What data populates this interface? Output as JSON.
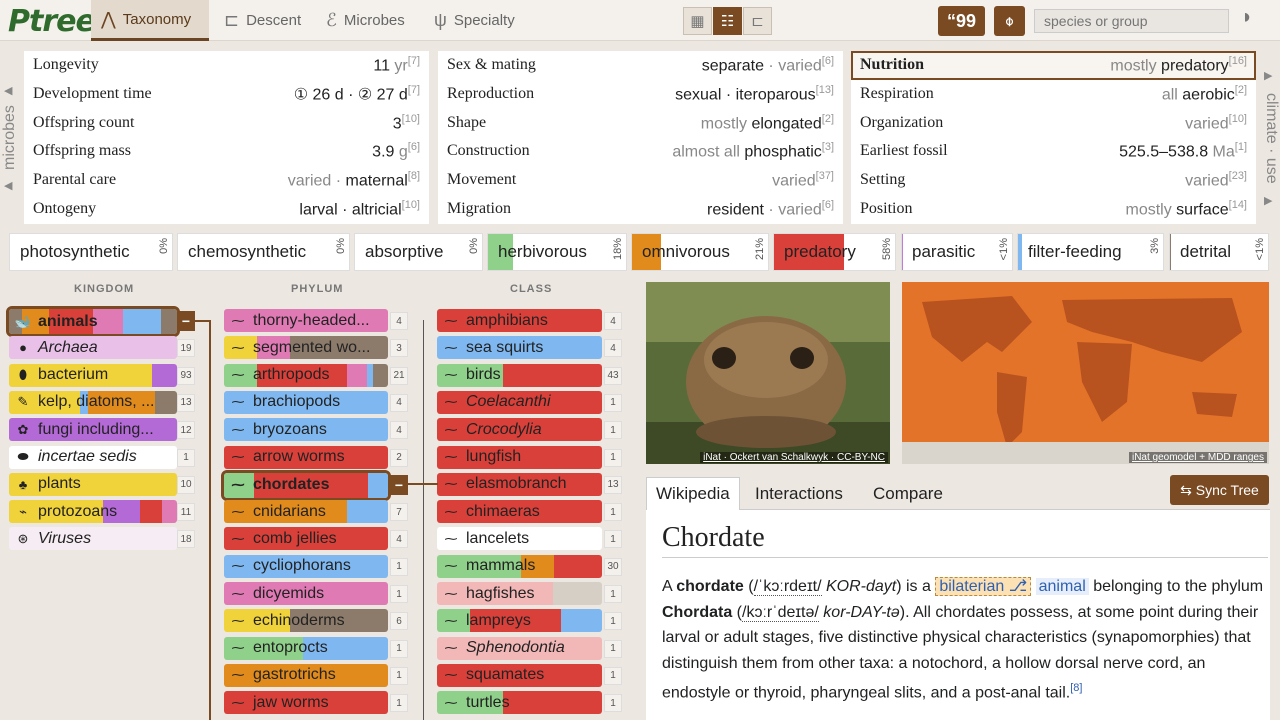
{
  "app": {
    "logo": "tree",
    "logo_p": "P"
  },
  "nav": {
    "tabs": [
      {
        "label": "Taxonomy",
        "icon": "taxonomy-icon"
      },
      {
        "label": "Descent",
        "icon": "descent-icon"
      },
      {
        "label": "Microbes",
        "icon": "microbes-icon"
      },
      {
        "label": "Specialty",
        "icon": "specialty-icon"
      }
    ],
    "search_placeholder": "species or group",
    "quote_label": "“99"
  },
  "side": {
    "left": "microbes",
    "right": "climate · use"
  },
  "facts": {
    "col1": [
      {
        "k": "Longevity",
        "v": "11",
        "u": " yr",
        "r": "[7]"
      },
      {
        "k": "Development time",
        "v": "① 26 d · ② 27 d",
        "u": "",
        "r": "[7]"
      },
      {
        "k": "Offspring count",
        "v": "3",
        "u": "",
        "r": "[10]"
      },
      {
        "k": "Offspring mass",
        "v": "3.9",
        "u": " g",
        "r": "[6]"
      },
      {
        "k": "Parental care",
        "m": "varied · ",
        "v": "maternal",
        "r": "[8]"
      },
      {
        "k": "Ontogeny",
        "v": "larval · altricial",
        "r": "[10]"
      }
    ],
    "col2": [
      {
        "k": "Sex & mating",
        "v": "separate",
        "m2": " · varied",
        "r": "[6]"
      },
      {
        "k": "Reproduction",
        "v": "sexual · iteroparous",
        "r": "[13]"
      },
      {
        "k": "Shape",
        "m": "mostly ",
        "v": "elongated",
        "r": "[2]"
      },
      {
        "k": "Construction",
        "m": "almost all ",
        "v": "phosphatic",
        "r": "[3]"
      },
      {
        "k": "Movement",
        "m": "varied",
        "v": "",
        "r": "[37]"
      },
      {
        "k": "Migration",
        "v": "resident",
        "m2": " · varied",
        "r": "[6]"
      }
    ],
    "col3": [
      {
        "k": "Nutrition",
        "m": "mostly ",
        "v": "predatory",
        "r": "[16]"
      },
      {
        "k": "Respiration",
        "m": "all ",
        "v": "aerobic",
        "r": "[2]"
      },
      {
        "k": "Organization",
        "m": "varied",
        "v": "",
        "r": "[10]"
      },
      {
        "k": "Earliest fossil",
        "v": "525.5–538.8",
        "u": " Ma",
        "r": "[1]"
      },
      {
        "k": "Setting",
        "m": "varied",
        "v": "",
        "r": "[23]"
      },
      {
        "k": "Position",
        "m": "mostly ",
        "v": "surface",
        "r": "[14]"
      }
    ]
  },
  "diets": [
    {
      "label": "photosynthetic",
      "pct": "0%",
      "color": "#7cc47a",
      "fill": 0
    },
    {
      "label": "chemosynthetic",
      "pct": "0%",
      "color": "#999",
      "fill": 0
    },
    {
      "label": "absorptive",
      "pct": "0%",
      "color": "#999",
      "fill": 0
    },
    {
      "label": "herbivorous",
      "pct": "18%",
      "color": "#8fd18a",
      "fill": 0.18
    },
    {
      "label": "omnivorous",
      "pct": "21%",
      "color": "#e08b1c",
      "fill": 0.21
    },
    {
      "label": "predatory",
      "pct": "58%",
      "color": "#d9403a",
      "fill": 0.58
    },
    {
      "label": "parasitic",
      "pct": "<1%",
      "color": "#c27bd6",
      "fill": 0.01
    },
    {
      "label": "filter-feeding",
      "pct": "3%",
      "color": "#7fb8f0",
      "fill": 0.03
    },
    {
      "label": "detrital",
      "pct": "<1%",
      "color": "#8c7b6a",
      "fill": 0.01
    }
  ],
  "columns": {
    "kingdom": "KINGDOM",
    "phylum": "PHYLUM",
    "class": "CLASS"
  },
  "kingdoms": [
    {
      "label": "animals",
      "count": "",
      "icon": "whale-icon"
    },
    {
      "label": "Archaea",
      "count": "19",
      "icon": "circle-icon"
    },
    {
      "label": "bacterium",
      "count": "93",
      "icon": "rod-icon"
    },
    {
      "label": "kelp, diatoms, ...",
      "count": "13",
      "icon": "kelp-icon"
    },
    {
      "label": "fungi including...",
      "count": "12",
      "icon": "fungus-icon"
    },
    {
      "label": "incertae sedis",
      "count": "1",
      "icon": "blob-icon"
    },
    {
      "label": "plants",
      "count": "10",
      "icon": "plant-icon"
    },
    {
      "label": "protozoans",
      "count": "11",
      "icon": "protozoan-icon"
    },
    {
      "label": "Viruses",
      "count": "18",
      "icon": "virus-icon"
    }
  ],
  "phyla": [
    {
      "label": "thorny-headed...",
      "count": "4"
    },
    {
      "label": "segmented wo...",
      "count": "3"
    },
    {
      "label": "arthropods",
      "count": "21"
    },
    {
      "label": "brachiopods",
      "count": "4"
    },
    {
      "label": "bryozoans",
      "count": "4"
    },
    {
      "label": "arrow worms",
      "count": "2"
    },
    {
      "label": "chordates",
      "count": ""
    },
    {
      "label": "cnidarians",
      "count": "7"
    },
    {
      "label": "comb jellies",
      "count": "4"
    },
    {
      "label": "cycliophorans",
      "count": "1"
    },
    {
      "label": "dicyemids",
      "count": "1"
    },
    {
      "label": "echinoderms",
      "count": "6"
    },
    {
      "label": "entoprocts",
      "count": "1"
    },
    {
      "label": "gastrotrichs",
      "count": "1"
    },
    {
      "label": "jaw worms",
      "count": "1"
    }
  ],
  "classes": [
    {
      "label": "amphibians",
      "count": "4"
    },
    {
      "label": "sea squirts",
      "count": "4"
    },
    {
      "label": "birds",
      "count": "43"
    },
    {
      "label": "Coelacanthi",
      "count": "1"
    },
    {
      "label": "Crocodylia",
      "count": "1"
    },
    {
      "label": "lungfish",
      "count": "1"
    },
    {
      "label": "elasmobranch",
      "count": "13"
    },
    {
      "label": "chimaeras",
      "count": "1"
    },
    {
      "label": "lancelets",
      "count": "1"
    },
    {
      "label": "mammals",
      "count": "30"
    },
    {
      "label": "hagfishes",
      "count": "1"
    },
    {
      "label": "lampreys",
      "count": "1"
    },
    {
      "label": "Sphenodontia",
      "count": "1"
    },
    {
      "label": "squamates",
      "count": "1"
    },
    {
      "label": "turtles",
      "count": "1"
    }
  ],
  "media": {
    "photo_caption": "iNat · Ockert van Schalkwyk · CC-BY-NC",
    "map_caption": "iNat geomodel + MDD ranges"
  },
  "wiki": {
    "tabs": [
      "Wikipedia",
      "Interactions",
      "Compare"
    ],
    "sync": "⇆ Sync Tree",
    "title": "Chordate",
    "p1": "A ",
    "b1": "chordate",
    "ipa1": "/ˈkɔːrdeɪt/",
    "resp1": " KOR-dayt",
    "p2": ") is a ",
    "pill1": "bilaterian ⎇",
    "pill2": "animal",
    "p3": " belonging to the phylum ",
    "b2": "Chordata",
    "ipa2": "/kɔːrˈdeɪtə/",
    "resp2": " kor-DAY-tə",
    "p4": "). All chordates possess, at some point during their larval or adult stages, five distinctive physical characteristics (synapomorphies) that distinguish them from other taxa: a notochord, a hollow dorsal nerve cord, an endostyle or thyroid, pharyngeal slits, and a post-anal tail.",
    "ref": "[8]"
  }
}
